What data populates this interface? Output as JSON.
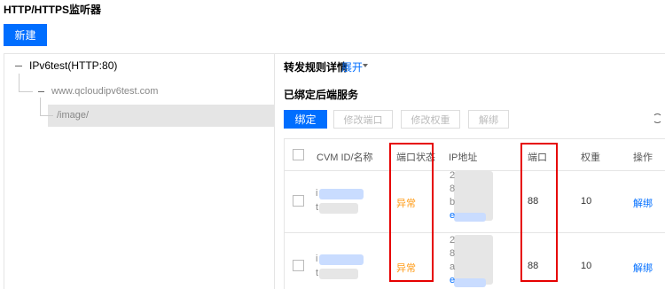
{
  "page_title": "HTTP/HTTPS监听器",
  "new_button": "新建",
  "tree": {
    "root_label": "IPv6test(HTTP:80)",
    "domain_label": "www.qcloudipv6test.com",
    "path_label": "/image/"
  },
  "rule_detail": {
    "label": "转发规则详情",
    "expand": "展开"
  },
  "bound_services": {
    "label": "已绑定后端服务",
    "buttons": [
      "绑定",
      "修改端口",
      "修改权重",
      "解绑"
    ]
  },
  "table": {
    "headers": [
      "CVM ID/名称",
      "端口状态",
      "IP地址",
      "端口",
      "权重",
      "操作"
    ],
    "rows": [
      {
        "id_prefix": "i",
        "name_prefix": "t",
        "port_status": "异常",
        "ip_lines": [
          "2",
          "8",
          "b",
          "e"
        ],
        "port": "88",
        "weight": "10",
        "action": "解绑"
      },
      {
        "id_prefix": "i",
        "name_prefix": "t",
        "port_status": "异常",
        "ip_lines": [
          "2",
          "8",
          "a",
          "e"
        ],
        "port": "88",
        "weight": "10",
        "action": "解绑"
      }
    ]
  },
  "colors": {
    "accent": "#006eff",
    "warning": "#ff9c19",
    "highlight_box": "#e60000"
  }
}
